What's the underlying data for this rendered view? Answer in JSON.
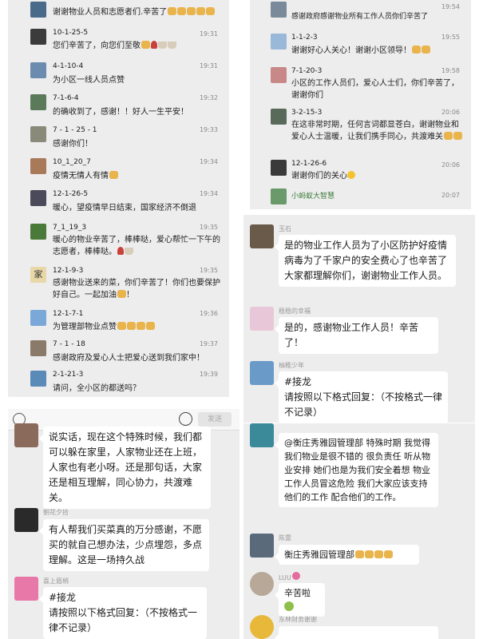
{
  "panel1": {
    "top_message": "谢谢物业人员和志愿者们.辛苦了",
    "rows": [
      {
        "name": "10-1-25-5",
        "time": "19:31",
        "text": "您们辛苦了，向您们至敬",
        "avatar_color": "#3b3b3b"
      },
      {
        "name": "4-1-10-4",
        "time": "19:31",
        "text": "为小区一线人员点赞",
        "avatar_color": "#6b8cae"
      },
      {
        "name": "7-1-6-4",
        "time": "19:32",
        "text": "的确收到了，感谢！！好人一生平安！",
        "avatar_color": "#5a7a5a"
      },
      {
        "name": "7 - 1 - 25 - 1",
        "time": "19:33",
        "text": "感谢你们！",
        "avatar_color": "#8a8a7a"
      },
      {
        "name": "10_1_20_7",
        "time": "19:34",
        "text": "疫情无情人有情",
        "avatar_color": "#a87a5a"
      },
      {
        "name": "12-1-26-5",
        "time": "19:34",
        "text": "暖心，望疫情早日结束，国家经济不倒退",
        "avatar_color": "#4a4a5a"
      },
      {
        "name": "7_1_19_3",
        "time": "19:35",
        "text": "暖心的物业辛苦了，棒棒哒，爱心帮忙一下午的志愿者，棒棒哒。",
        "avatar_color": "#4a7a3a"
      },
      {
        "name": "12-1-9-3",
        "time": "19:35",
        "text": "感谢物业送来的菜，你们辛苦了！你们也要保护好自己。一起加油",
        "avatar_color": "#e8d8a8",
        "avatar_char": "家"
      },
      {
        "name": "12-1-7-1",
        "time": "19:36",
        "text": "为管理部物业点赞",
        "avatar_color": "#7aa8d8"
      },
      {
        "name": "7 - 1 - 18",
        "time": "19:37",
        "text": "感谢政府及爱心人士把爱心送到我们家中！",
        "avatar_color": "#8a7a6a"
      },
      {
        "name": "2-1-21-3",
        "time": "19:39",
        "text": "请问，全小区的都送吗？",
        "avatar_color": "#5a8ab8"
      }
    ]
  },
  "panel2": {
    "rows": [
      {
        "name": "",
        "time": "19:54",
        "text": "感谢政府感谢物业所有工作人员你们辛苦了",
        "avatar_color": "#7a8a9a"
      },
      {
        "name": "1-1-2-3",
        "time": "19:55",
        "text": "谢谢好心人关心！谢谢小区领导！",
        "avatar_color": "#9ab8d8"
      },
      {
        "name": "7-1-20-3",
        "time": "19:58",
        "text": "小区的工作人员们，爱心人士们，你们辛苦了，谢谢你们",
        "avatar_color": "#c88888"
      },
      {
        "name": "3-2-15-3",
        "time": "20:06",
        "text": "在这非常时期，任何言词都显苍白，谢谢物业和爱心人士温暖，让我们携手同心，共渡难关",
        "avatar_color": "#5a6a5a"
      },
      {
        "name": "12-1-26-6",
        "time": "20:06",
        "text": "谢谢你们的关心",
        "avatar_color": "#3a3a3a"
      },
      {
        "name": "小蚂蚁大智慧",
        "time": "20:07",
        "text": "",
        "avatar_color": "#6a9a6a"
      }
    ]
  },
  "panel3": {
    "messages": [
      {
        "name": "玉石",
        "text": "是的物业工作人员为了小区防护好疫情病毒为了千家户的安全费心了也辛苦了大家都理解你们，谢谢物业工作人员。",
        "avatar_color": "#6a5a4a"
      },
      {
        "name": "稳稳的幸福",
        "text": "是的，感谢物业工作人员！辛苦了！",
        "avatar_color": "#e8c8d8"
      },
      {
        "name": "柚稚少年",
        "text": "#接龙\n请按照以下格式回复：（不按格式一律不记录）",
        "avatar_color": "#6a9ac8"
      }
    ]
  },
  "panel4": {
    "input_bar": {
      "send_label": "发送"
    },
    "messages": [
      {
        "name": "",
        "text": "说实话，现在这个特殊时候，我们都可以躲在家里，人家物业还在上班，人家也有老小呀。还是那句话，大家还是相互理解，同心协力，共渡难关。",
        "avatar_color": "#8a6a5a"
      },
      {
        "name": "朝花夕拾",
        "text": "有人帮我们买菜真的万分感谢，不愿买的就自己想办法，少点埋怨，多点理解。这是一场持久战",
        "avatar_color": "#2a2a2a"
      },
      {
        "name": "喜上眉梢",
        "text": "#接龙\n请按照以下格式回复：（不按格式一律不记录）",
        "avatar_color": "#e878a8"
      }
    ]
  },
  "panel5": {
    "messages": [
      {
        "name": "",
        "text": "@衡庄秀雅园管理部  特殊时期 我觉得我们物业是很不错的 很负责任  听从物业安排 她们也是为我们安全着想 物业工作人员冒这危险 我们大家应该支持他们的工作 配合他们的工作。",
        "avatar_color": "#3a8a9a"
      },
      {
        "name": "陈雷",
        "text": "衡庄秀雅园管理部",
        "avatar_color": "#5a6a7a"
      },
      {
        "name": "LUU",
        "text": "辛苦啦",
        "avatar_color": "#b8a898"
      },
      {
        "name": "东林财务谢谢",
        "text": "",
        "avatar_color": "#e8b83a"
      }
    ]
  }
}
